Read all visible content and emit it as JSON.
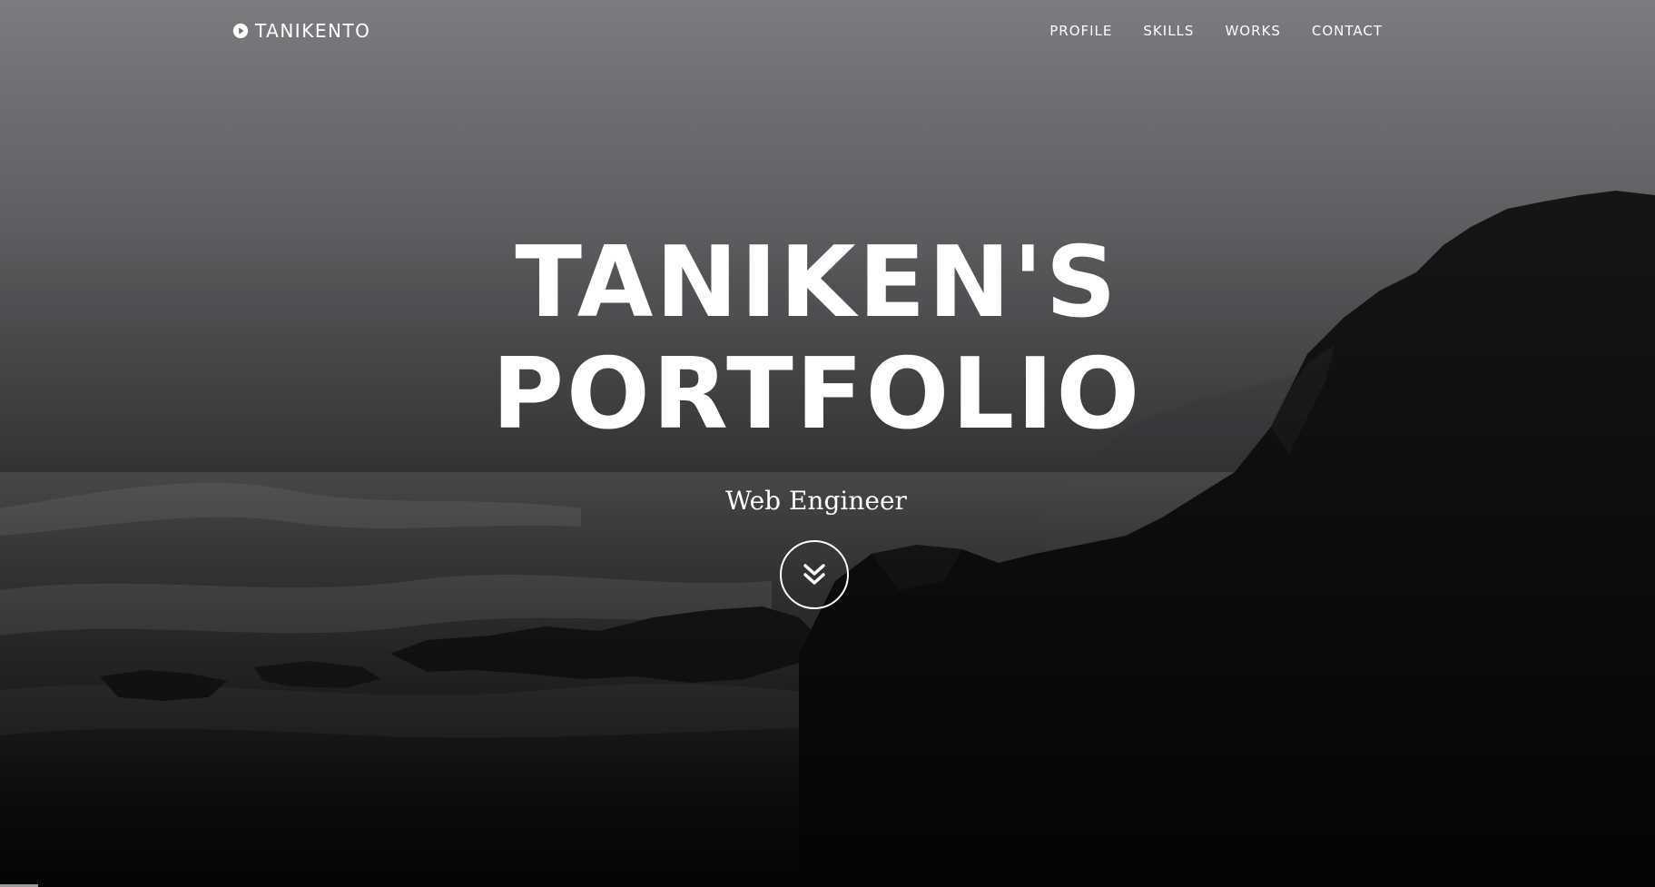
{
  "brand": {
    "name": "TANIKENTO",
    "icon": "play-circle-icon"
  },
  "nav": {
    "items": [
      {
        "label": "PROFILE"
      },
      {
        "label": "SKILLS"
      },
      {
        "label": "WORKS"
      },
      {
        "label": "CONTACT"
      }
    ]
  },
  "hero": {
    "title_line1": "TANIKEN'S",
    "title_line2": "PORTFOLIO",
    "subtitle": "Web Engineer",
    "scroll_icon": "double-chevron-down-icon"
  },
  "colors": {
    "text": "#ffffff",
    "sky": "#7a7c7f",
    "rocks": "#1a1a1b"
  }
}
